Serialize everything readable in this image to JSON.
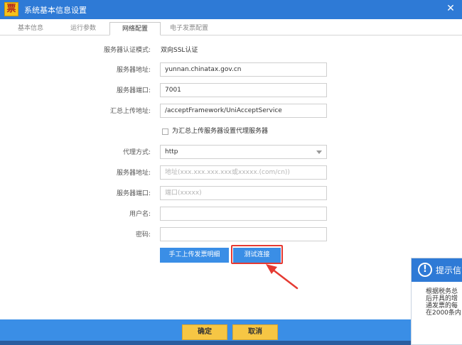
{
  "window": {
    "app_icon_glyph": "票",
    "title": "系统基本信息设置",
    "close_glyph": "✕"
  },
  "tabs": [
    {
      "label": "基本信息",
      "active": false
    },
    {
      "label": "运行参数",
      "active": false
    },
    {
      "label": "网络配置",
      "active": true
    },
    {
      "label": "电子发票配置",
      "active": false
    }
  ],
  "form": {
    "auth_mode_label": "服务器认证模式:",
    "auth_mode_value": "双向SSL认证",
    "server_addr_label": "服务器地址:",
    "server_addr_value": "yunnan.chinatax.gov.cn",
    "server_port_label": "服务器端口:",
    "server_port_value": "7001",
    "upload_addr_label": "汇总上传地址:",
    "upload_addr_value": "/acceptFramework/UniAcceptService",
    "proxy_checkbox_label": "为汇总上传服务器设置代理服务器",
    "proxy_checkbox_checked": false,
    "proxy_mode_label": "代理方式:",
    "proxy_mode_value": "http",
    "proxy_server_label": "服务器地址:",
    "proxy_server_placeholder": "地址(xxx.xxx.xxx.xxx或xxxxx.(com/cn))",
    "proxy_port_label": "服务器端口:",
    "proxy_port_placeholder": "端口(xxxxx)",
    "username_label": "用户名:",
    "username_value": "",
    "password_label": "密码:",
    "password_value": ""
  },
  "actions": {
    "manual_upload_label": "手工上传发票明细",
    "test_connection_label": "测试连接"
  },
  "footer": {
    "ok_label": "确定",
    "cancel_label": "取消"
  },
  "popup": {
    "icon_glyph": "!",
    "title": "提示信",
    "body_lines": [
      "根据税务总",
      "后开具的增",
      "通发票的每",
      "在2000条内"
    ]
  },
  "colors": {
    "accent": "#2e7ad6",
    "button_blue": "#3a8ee6",
    "highlight_red": "#e53a32",
    "button_yellow": "#f6c644"
  }
}
